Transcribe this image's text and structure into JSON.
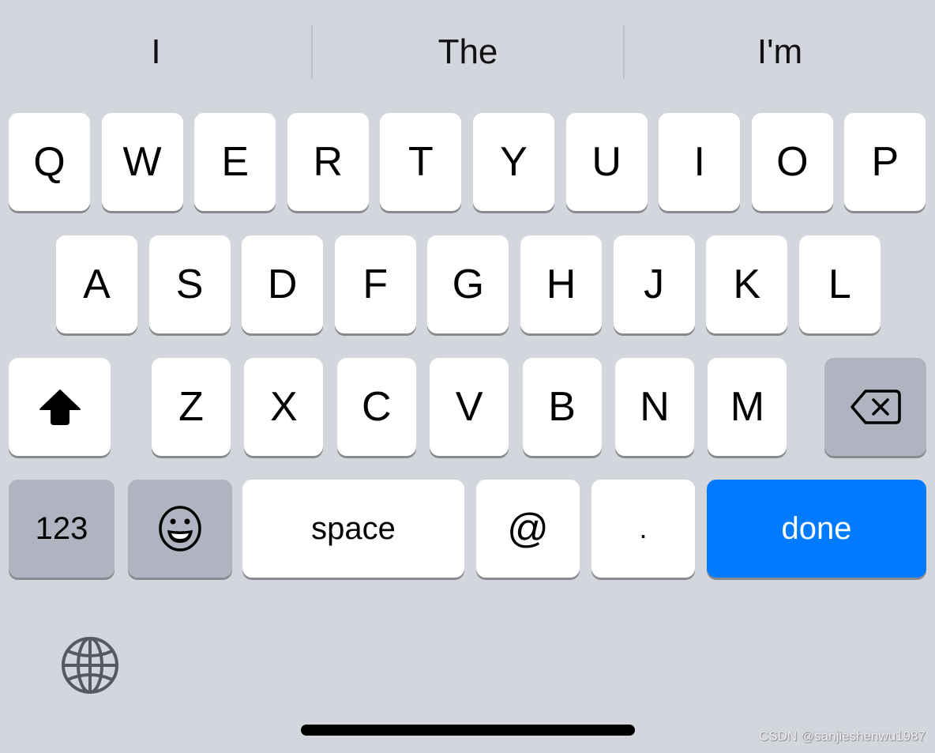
{
  "suggestions": [
    "I",
    "The",
    "I'm"
  ],
  "rows": {
    "row1": [
      "Q",
      "W",
      "E",
      "R",
      "T",
      "Y",
      "U",
      "I",
      "O",
      "P"
    ],
    "row2": [
      "A",
      "S",
      "D",
      "F",
      "G",
      "H",
      "J",
      "K",
      "L"
    ],
    "row3": [
      "Z",
      "X",
      "C",
      "V",
      "B",
      "N",
      "M"
    ]
  },
  "keys": {
    "shift_icon": "shift-arrow-up",
    "delete_icon": "delete-backspace",
    "numbers": "123",
    "emoji_icon": "smiley-face",
    "space": "space",
    "at": "@",
    "period": ".",
    "done": "done",
    "globe_icon": "globe"
  },
  "colors": {
    "keyboard_bg": "#d3d6dd",
    "key_light": "#ffffff",
    "key_dark": "#b0b4c0",
    "accent": "#007aff"
  },
  "watermark": "CSDN @sanjieshenwu1987"
}
